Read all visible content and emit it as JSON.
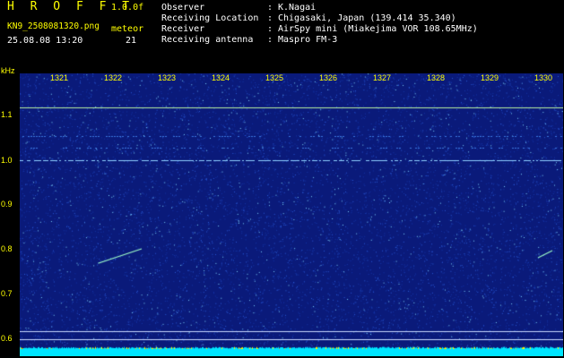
{
  "header": {
    "title": "H R O F F T",
    "version": "1.0.0f",
    "filename": "KN9_2508081320.png",
    "timestamp": "25.08.08 13:20",
    "meteor_label": "meteor",
    "meteor_count": "21"
  },
  "meta": [
    {
      "key": "Observer",
      "value": "K.Nagai"
    },
    {
      "key": "Receiving Location",
      "value": "Chigasaki, Japan (139.414 35.340)"
    },
    {
      "key": "Receiver",
      "value": "AirSpy mini (Miakejima VOR 108.65MHz)"
    },
    {
      "key": "Receiving antenna",
      "value": "Maspro FM-3"
    }
  ],
  "axis": {
    "unit": "kHz",
    "y_ticks": [
      "1.1",
      "1.0",
      "0.9",
      "0.8",
      "0.7",
      "0.6"
    ],
    "x_ticks": [
      "1321",
      "1322",
      "1323",
      "1324",
      "1325",
      "1326",
      "1327",
      "1328",
      "1329",
      "1330"
    ]
  },
  "colors": {
    "text_yellow": "#ffff00",
    "text_white": "#ffffff",
    "background_blue": "#0a1a7a",
    "noise_cyan": "#00e5ff"
  }
}
